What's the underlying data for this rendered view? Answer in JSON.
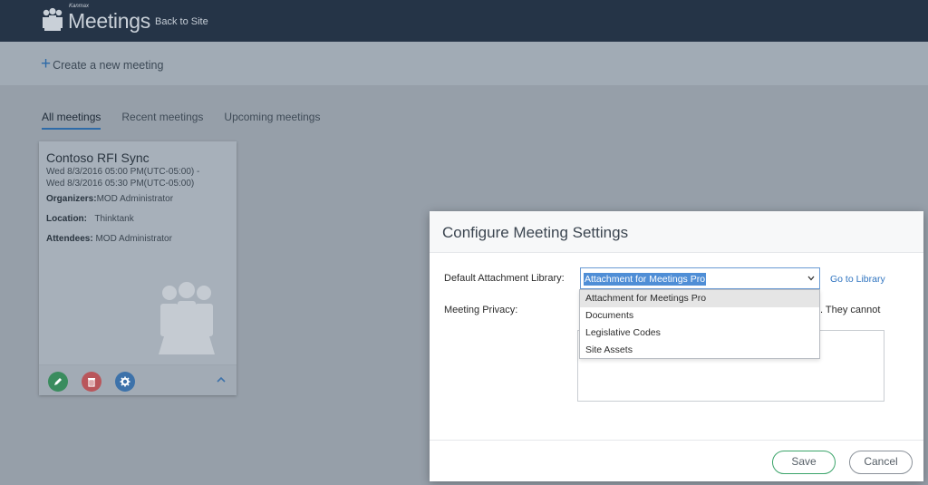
{
  "topbar": {
    "brand": "Kanmax",
    "app_title": "Meetings",
    "back_link": "Back to Site"
  },
  "subbar": {
    "create_label": "Create a new meeting"
  },
  "tabs": [
    "All meetings",
    "Recent meetings",
    "Upcoming meetings"
  ],
  "active_tab": "All meetings",
  "meeting_card": {
    "title": "Contoso RFI Sync",
    "date_line1": "Wed 8/3/2016 05:00 PM(UTC-05:00) -",
    "date_line2": "Wed 8/3/2016 05:30 PM(UTC-05:00)",
    "organizers_label": "Organizers:",
    "organizers_value": "MOD Administrator",
    "location_label": "Location:",
    "location_value": "Thinktank",
    "attendees_label": "Attendees:",
    "attendees_value": "MOD Administrator"
  },
  "dialog": {
    "title": "Configure Meeting Settings",
    "default_library_label": "Default Attachment Library:",
    "selected_library": "Attachment for Meetings Pro",
    "go_to_library": "Go to Library",
    "privacy_label": "Meeting Privacy:",
    "privacy_text_partial": ". They cannot",
    "library_options": [
      "Attachment for Meetings Pro",
      "Documents",
      "Legislative Codes",
      "Site Assets"
    ],
    "save_label": "Save",
    "cancel_label": "Cancel"
  },
  "colors": {
    "topbar": "#253447",
    "accent_blue": "#2e6ba8",
    "save_border": "#3ba46a",
    "edit_button": "#3a8c5e",
    "delete_button": "#b9565b",
    "settings_button": "#3d72aa"
  }
}
